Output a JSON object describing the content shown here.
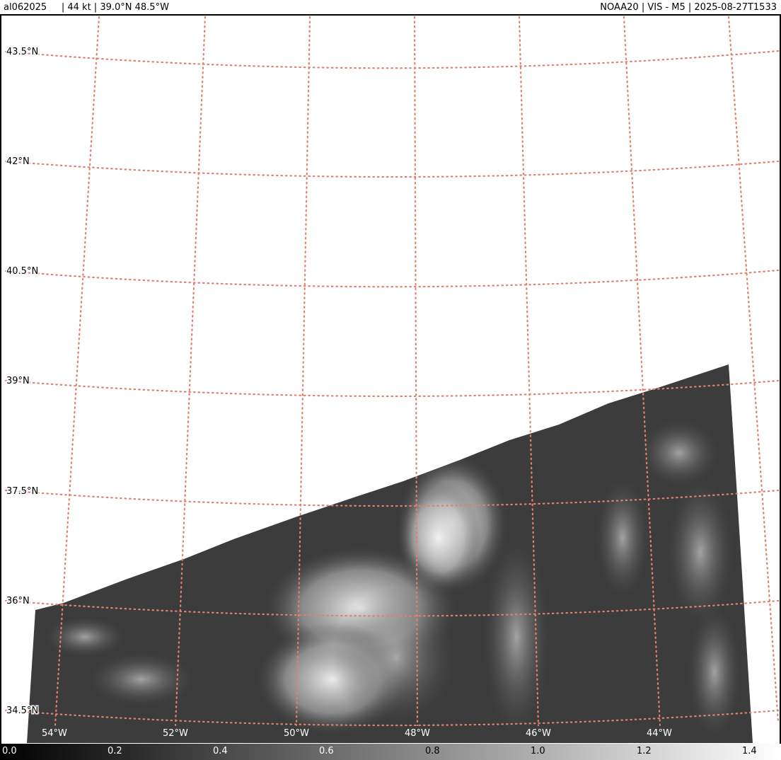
{
  "header": {
    "left": "al062025     | 44 kt | 39.0°N 48.5°W",
    "right": "NOAA20 | VIS - M5 | 2025-08-27T1533"
  },
  "map": {
    "latitude_labels": [
      "43.5°N",
      "42°N",
      "40.5°N",
      "39°N",
      "37.5°N",
      "36°N",
      "34.5°N"
    ],
    "longitude_labels": [
      "54°W",
      "52°W",
      "50°W",
      "48°W",
      "46°W",
      "44°W"
    ],
    "gridline_color": "#e08070",
    "background_color": "#ffffff",
    "data_edge_color": "#3c3c3c",
    "cloud_color": "#f0f0f0"
  },
  "colorbar": {
    "min": 0.0,
    "max": 1.4,
    "tick_labels": [
      "0.0",
      "0.2",
      "0.4",
      "0.6",
      "0.8",
      "1.0",
      "1.2",
      "1.4"
    ],
    "gradient": [
      "#000000",
      "#ffffff"
    ]
  }
}
